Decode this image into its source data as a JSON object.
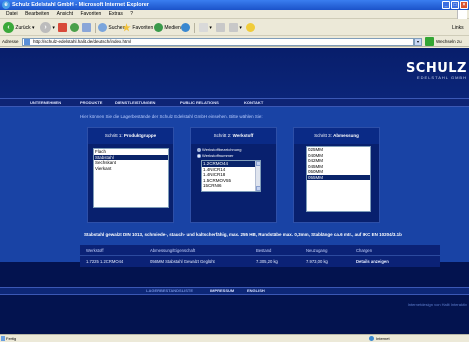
{
  "window": {
    "title": "Schulz Edelstahl GmbH - Microsoft Internet Explorer",
    "min_glyph": "_",
    "max_glyph": "□",
    "close_glyph": "×"
  },
  "menu": [
    "Datei",
    "Bearbeiten",
    "Ansicht",
    "Favoriten",
    "Extras",
    "?"
  ],
  "toolbar": {
    "back": "Zurück",
    "search": "Suchen",
    "favorites": "Favoriten",
    "media": "Medien",
    "links": "Links"
  },
  "address": {
    "label": "Adresse",
    "url": "http://schulz-edelstahl.halit.de/deutsch/index.html",
    "go_label": "Wechseln zu"
  },
  "site": {
    "logo_main": "SCHULZ",
    "logo_sub": "EDELSTAHL GMBH",
    "nav": [
      "UNTERNEHMEN",
      "PRODUKTE",
      "DIENSTLEISTUNGEN",
      "PUBLIC RELATIONS",
      "KONTAKT"
    ],
    "intro": "Hier können Sie die Lagerbestände der Schulz Edelstahl GmbH einsehen. Bitte wählen Sie:",
    "steps": [
      {
        "step": "Schritt 1:",
        "title": "Produktgruppe",
        "options": [
          "Flach",
          "Stabstahl",
          "Sechskant",
          "Vierkant"
        ],
        "selected": 1
      },
      {
        "step": "Schritt 2:",
        "title": "Werkstoff",
        "radios": [
          "Werkstoffbezeichnung",
          "Werkstoffnummer"
        ],
        "radio_selected": 0,
        "options": [
          "1.2CRMO44",
          "1.4NICR14",
          "1.4NICR18",
          "1.5CRMOV55",
          "15CRNI6"
        ],
        "selected": 0
      },
      {
        "step": "Schritt 3:",
        "title": "Abmessung",
        "options": [
          "025MM",
          "040MM",
          "042MM",
          "045MM",
          "050MM",
          "055MM"
        ],
        "selected": 5
      }
    ],
    "description": "Stabstahl gewalzt DIN 1013, schmiede-, stauch- und kaltscherfähig, max. 255 HB, Rundstäbe max. 0,3mm, Stablänge ca.6 mtr., auf IKC EN 10204/3.1b",
    "results_header": [
      "Werkstoff",
      "Abmessung/Eigenschaft",
      "Bestand",
      "Neuzugang",
      "Chargen"
    ],
    "results_row": [
      "1.7225 1.2CRMO44",
      "056MM Stabstahl Gewalzt Geglüht",
      "7.305,20 kg",
      "7.973,00 kg",
      "Details anzeigen"
    ],
    "footer_nav": [
      "LAGERBESTANDSLISTE",
      "IMPRESSUM",
      "ENGLISH"
    ],
    "design_credit": "Internetdesign von Halit Interaktiv"
  },
  "status": {
    "text": "Fertig",
    "zone": "Internet"
  }
}
